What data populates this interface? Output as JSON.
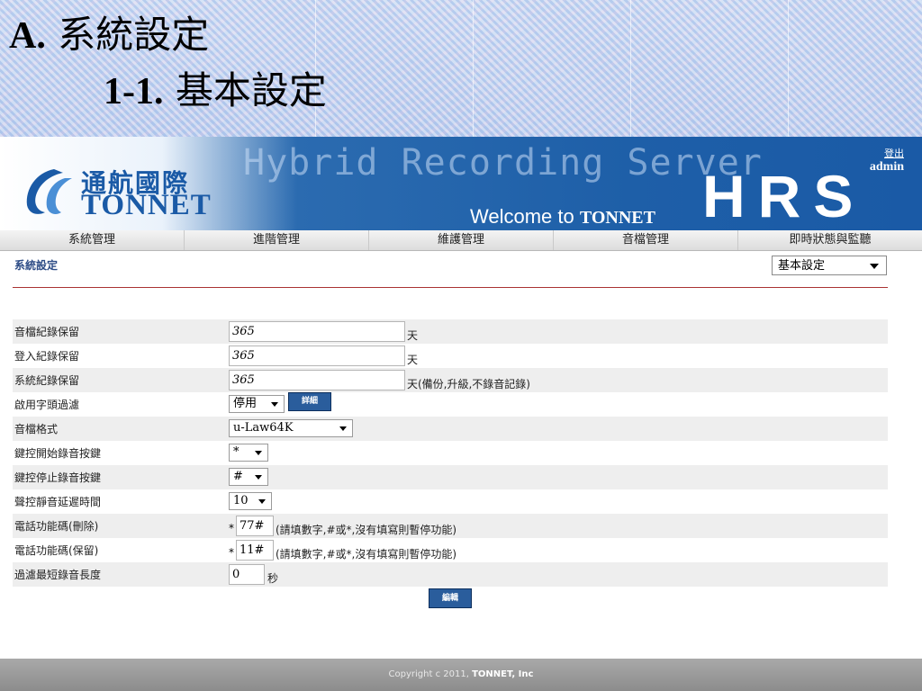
{
  "slide": {
    "title_prefix": "A.",
    "title_text": "系統設定",
    "sub_prefix": "1-1.",
    "sub_text": "基本設定"
  },
  "banner": {
    "logo_zh": "通航國際",
    "logo_en": "TONNET",
    "product": "Hybrid Recording Server",
    "welcome_prefix": "Welcome to",
    "welcome_brand": "TONNET",
    "brand_mark": "HRS",
    "logout": "登出",
    "user": "admin"
  },
  "nav": [
    "系統管理",
    "進階管理",
    "維護管理",
    "音檔管理",
    "即時狀態與監聽"
  ],
  "section_title": "系統設定",
  "page_select": "基本設定",
  "form": {
    "audio_retention": {
      "label": "音檔紀錄保留",
      "value": "365",
      "unit": "天"
    },
    "login_retention": {
      "label": "登入紀錄保留",
      "value": "365",
      "unit": "天"
    },
    "system_retention": {
      "label": "系統紀錄保留",
      "value": "365",
      "unit": "天(備份,升級,不錄音記錄)"
    },
    "prefix_filter": {
      "label": "啟用字頭過濾",
      "value": "停用",
      "detail_button": "詳細"
    },
    "audio_format": {
      "label": "音檔格式",
      "value": "u-Law64K"
    },
    "start_key": {
      "label": "鍵控開始錄音按鍵",
      "value": "*"
    },
    "stop_key": {
      "label": "鍵控停止錄音按鍵",
      "value": "#"
    },
    "silence_delay": {
      "label": "聲控靜音延遲時間",
      "value": "10"
    },
    "func_delete": {
      "label": "電話功能碼(刪除)",
      "prefix": "*",
      "value": "77#",
      "hint": "(請填數字,#或*,沒有填寫則暫停功能)"
    },
    "func_keep": {
      "label": "電話功能碼(保留)",
      "prefix": "*",
      "value": "11#",
      "hint": "(請填數字,#或*,沒有填寫則暫停功能)"
    },
    "min_length": {
      "label": "過濾最短錄音長度",
      "value": "0",
      "unit": "秒"
    },
    "submit": "編輯"
  },
  "footer": {
    "text": "Copyright c 2011,",
    "brand": "TONNET, Inc"
  }
}
